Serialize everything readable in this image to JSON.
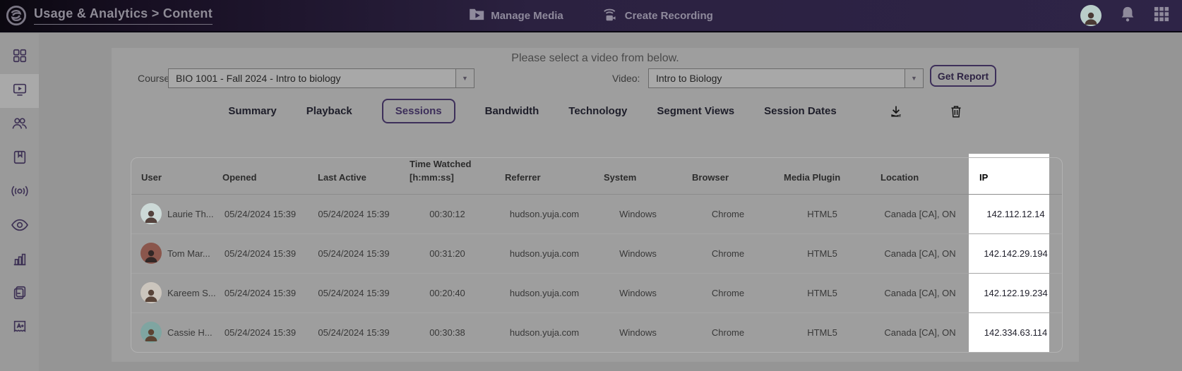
{
  "topbar": {
    "breadcrumb": "Usage & Analytics > Content",
    "manage_media_label": "Manage Media",
    "create_recording_label": "Create Recording"
  },
  "sidebar": {
    "items": [
      {
        "icon": "dashboard-icon",
        "selected": false
      },
      {
        "icon": "media-library-icon",
        "selected": true
      },
      {
        "icon": "users-icon",
        "selected": false
      },
      {
        "icon": "courses-book-icon",
        "selected": false
      },
      {
        "icon": "live-stream-icon",
        "selected": false
      },
      {
        "icon": "visibility-eye-icon",
        "selected": false
      },
      {
        "icon": "analytics-chart-icon",
        "selected": false
      },
      {
        "icon": "documents-icon",
        "selected": false
      },
      {
        "icon": "gradebook-a-plus-icon",
        "selected": false
      }
    ]
  },
  "filters": {
    "message": "Please select a video from below.",
    "course_label": "Course:",
    "course_value": "BIO 1001 - Fall 2024 - Intro to biology",
    "video_label": "Video:",
    "video_value": "Intro to Biology",
    "get_report_label": "Get Report"
  },
  "tabs": {
    "items": [
      "Summary",
      "Playback",
      "Sessions",
      "Bandwidth",
      "Technology",
      "Segment Views",
      "Session Dates"
    ],
    "active": "Sessions",
    "icons": [
      "download-icon",
      "trash-icon"
    ]
  },
  "table": {
    "columns": [
      {
        "label": "User"
      },
      {
        "label": "Opened"
      },
      {
        "label": "Last Active"
      },
      {
        "label": "Time Watched",
        "sublabel": "[h:mm:ss]"
      },
      {
        "label": "Referrer"
      },
      {
        "label": "System"
      },
      {
        "label": "Browser"
      },
      {
        "label": "Media Plugin"
      },
      {
        "label": "Location"
      },
      {
        "label": "IP",
        "highlighted": true
      }
    ],
    "rows": [
      {
        "user": "Laurie Th...",
        "opened": "05/24/2024 15:39",
        "last_active": "05/24/2024 15:39",
        "time_watched": "00:30:12",
        "referrer": "hudson.yuja.com",
        "system": "Windows",
        "browser": "Chrome",
        "media_plugin": "HTML5",
        "location": "Canada [CA], ON",
        "ip": "142.112.12.14",
        "avatar": {
          "bg": "#ccd9d7",
          "fg": "#54423d"
        }
      },
      {
        "user": "Tom Mar...",
        "opened": "05/24/2024 15:39",
        "last_active": "05/24/2024 15:39",
        "time_watched": "00:31:20",
        "referrer": "hudson.yuja.com",
        "system": "Windows",
        "browser": "Chrome",
        "media_plugin": "HTML5",
        "location": "Canada [CA], ON",
        "ip": "142.142.29.194",
        "avatar": {
          "bg": "#8a564c",
          "fg": "#322726"
        }
      },
      {
        "user": "Kareem S...",
        "opened": "05/24/2024 15:39",
        "last_active": "05/24/2024 15:39",
        "time_watched": "00:20:40",
        "referrer": "hudson.yuja.com",
        "system": "Windows",
        "browser": "Chrome",
        "media_plugin": "HTML5",
        "location": "Canada [CA], ON",
        "ip": "142.122.19.234",
        "avatar": {
          "bg": "#cbc5bd",
          "fg": "#594439"
        }
      },
      {
        "user": "Cassie H...",
        "opened": "05/24/2024 15:39",
        "last_active": "05/24/2024 15:39",
        "time_watched": "00:30:38",
        "referrer": "hudson.yuja.com",
        "system": "Windows",
        "browser": "Chrome",
        "media_plugin": "HTML5",
        "location": "Canada [CA], ON",
        "ip": "142.334.63.114",
        "avatar": {
          "bg": "#7fa5a1",
          "fg": "#5c4433"
        }
      }
    ]
  },
  "colors": {
    "accent_purple": "#3d2f5a",
    "topbar_bg": "#2c2241",
    "page_bg": "#959595",
    "panel_bg": "#9e9e9e",
    "spotlight": "#ffffff",
    "sidebar_icon": "#3d3154"
  }
}
